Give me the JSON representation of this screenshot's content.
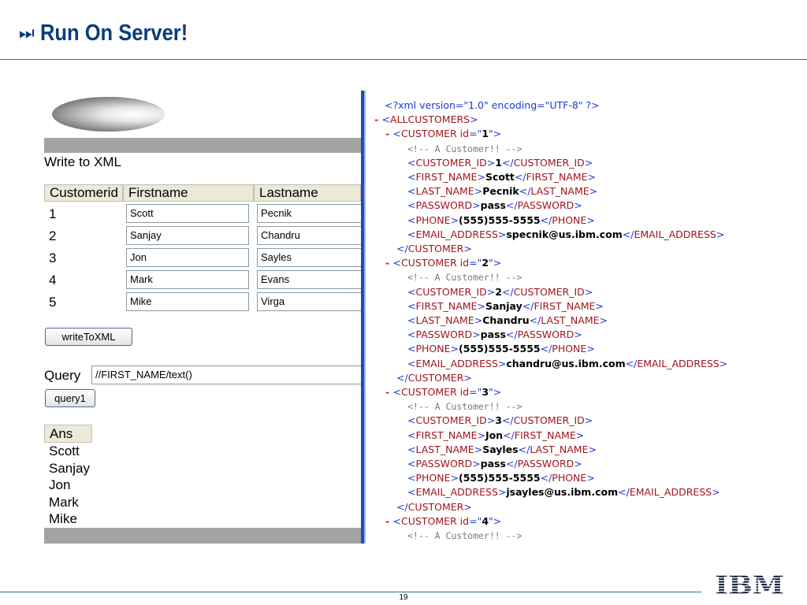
{
  "slide": {
    "title_glyph": "⏭",
    "title": "Run On Server!",
    "page_number": "19",
    "logo_text": "IBM"
  },
  "app": {
    "write_label": "Write to XML",
    "grid_headers": [
      "Customerid",
      "Firstname",
      "Lastname"
    ],
    "rows": [
      {
        "id": "1",
        "first": "Scott",
        "last": "Pecnik"
      },
      {
        "id": "2",
        "first": "Sanjay",
        "last": "Chandru"
      },
      {
        "id": "3",
        "first": "Jon",
        "last": "Sayles"
      },
      {
        "id": "4",
        "first": "Mark",
        "last": "Evans"
      },
      {
        "id": "5",
        "first": "Mike",
        "last": "Virga"
      }
    ],
    "write_button": "writeToXML",
    "query_label": "Query",
    "query_value": "//FIRST_NAME/text()",
    "query_button": "query1",
    "ans_header": "Ans",
    "answers": [
      "Scott",
      "Sanjay",
      "Jon",
      "Mark",
      "Mike"
    ]
  },
  "xml": {
    "declaration": "<?xml version=\"1.0\" encoding=\"UTF-8\" ?>",
    "minus_symbol": "-",
    "root_tag": "ALLCUSTOMERS",
    "customer_tag": "CUSTOMER",
    "id_attr": "id",
    "comment": "<!-- A Customer!! -->",
    "customers": [
      {
        "id": "1",
        "customer_id": "1",
        "first_name": "Scott",
        "last_name": "Pecnik",
        "password": "pass",
        "phone": "(555)555-5555",
        "email": "specnik@us.ibm.com"
      },
      {
        "id": "2",
        "customer_id": "2",
        "first_name": "Sanjay",
        "last_name": "Chandru",
        "password": "pass",
        "phone": "(555)555-5555",
        "email": "chandru@us.ibm.com"
      },
      {
        "id": "3",
        "customer_id": "3",
        "first_name": "Jon",
        "last_name": "Sayles",
        "password": "pass",
        "phone": "(555)555-5555",
        "email": "jsayles@us.ibm.com"
      },
      {
        "id": "4"
      }
    ],
    "field_tags": [
      "CUSTOMER_ID",
      "FIRST_NAME",
      "LAST_NAME",
      "PASSWORD",
      "PHONE",
      "EMAIL_ADDRESS"
    ]
  },
  "colors": {
    "title": "#0a3d7a",
    "rule": "#2f6f87",
    "divider": "#1b4fb5",
    "xml_tag": "#a0151e",
    "xml_punct": "#1c39d6",
    "xml_minus": "#d42020"
  }
}
